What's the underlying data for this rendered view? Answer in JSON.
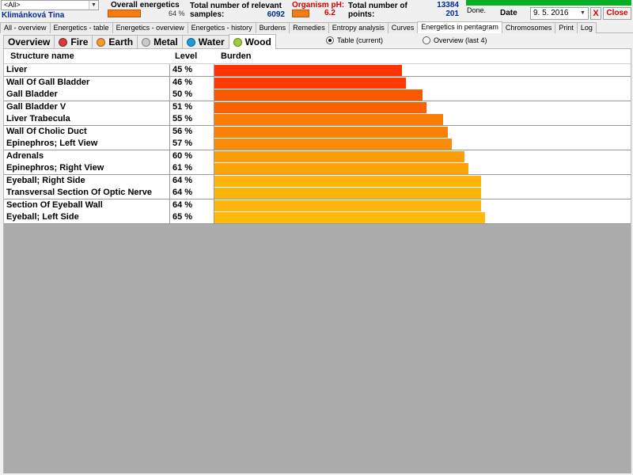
{
  "header": {
    "filter_combo": "<All>",
    "patient_name": "Klimánková Tina",
    "overall_energetics_label": "Overall energetics",
    "overall_energetics_value": "64 %",
    "relevant_samples_label_1": "Total number of relevant",
    "relevant_samples_label_2": "samples:",
    "relevant_samples_value": "6092",
    "organism_ph_label": "Organism pH:",
    "organism_ph_value": "6.2",
    "total_points_label_1": "Total number of",
    "total_points_label_2": "points:",
    "total_points_value_1": "13384",
    "total_points_value_2": "201",
    "status": "Done.",
    "progress": 1.0,
    "date_label": "Date",
    "date_value": "9. 5. 2016",
    "x_label": "X",
    "close_label": "Close"
  },
  "main_tabs": [
    {
      "label": "All - overview",
      "active": false
    },
    {
      "label": "Energetics - table",
      "active": false
    },
    {
      "label": "Energetics - overview",
      "active": false
    },
    {
      "label": "Energetics - history",
      "active": false
    },
    {
      "label": "Burdens",
      "active": false
    },
    {
      "label": "Remedies",
      "active": false
    },
    {
      "label": "Entropy analysis",
      "active": false
    },
    {
      "label": "Curves",
      "active": false
    },
    {
      "label": "Energetics in pentagram",
      "active": true
    },
    {
      "label": "Chromosomes",
      "active": false
    },
    {
      "label": "Print",
      "active": false
    },
    {
      "label": "Log",
      "active": false
    }
  ],
  "element_tabs": [
    {
      "label": "Overview",
      "color": null,
      "active": false
    },
    {
      "label": "Fire",
      "color": "#d63b3b",
      "active": false
    },
    {
      "label": "Earth",
      "color": "#f39a2a",
      "active": false
    },
    {
      "label": "Metal",
      "color": "#c9c9c9",
      "active": false
    },
    {
      "label": "Water",
      "color": "#1f9bd6",
      "active": false
    },
    {
      "label": "Wood",
      "color": "#9ccf3c",
      "active": true
    }
  ],
  "view_options": {
    "table_label": "Table (current)",
    "overview_label": "Overview (last 4)",
    "selected": "table"
  },
  "table": {
    "columns": [
      "Structure name",
      "Level",
      "Burden"
    ],
    "rows": [
      {
        "name": "Liver",
        "level": "45 %",
        "burden": 45,
        "color": "#fd3300"
      },
      {
        "name": "Wall Of Gall Bladder",
        "level": "46 %",
        "burden": 46,
        "color": "#fd3b00"
      },
      {
        "name": "Gall Bladder",
        "level": "50 %",
        "burden": 50,
        "color": "#fb5900"
      },
      {
        "name": "Gall Bladder V",
        "level": "51 %",
        "burden": 51,
        "color": "#fb6100"
      },
      {
        "name": "Liver Trabecula",
        "level": "55 %",
        "burden": 55,
        "color": "#fa7b06"
      },
      {
        "name": "Wall Of Cholic Duct",
        "level": "56 %",
        "burden": 56,
        "color": "#fa8307"
      },
      {
        "name": "Epinephros; Left View",
        "level": "57 %",
        "burden": 57,
        "color": "#fb8b0a"
      },
      {
        "name": "Adrenals",
        "level": "60 %",
        "burden": 60,
        "color": "#fc9e0b"
      },
      {
        "name": "Epinephros; Right View",
        "level": "61 %",
        "burden": 61,
        "color": "#fda40b"
      },
      {
        "name": "Eyeball; Right Side",
        "level": "64 %",
        "burden": 64,
        "color": "#feb40b"
      },
      {
        "name": "Transversal Section Of Optic Nerve",
        "level": "64 %",
        "burden": 64,
        "color": "#feb40b"
      },
      {
        "name": "Section Of Eyeball Wall",
        "level": "64 %",
        "burden": 64,
        "color": "#feb40b"
      },
      {
        "name": "Eyeball; Left Side",
        "level": "65 %",
        "burden": 65,
        "color": "#ffba0b"
      }
    ]
  }
}
